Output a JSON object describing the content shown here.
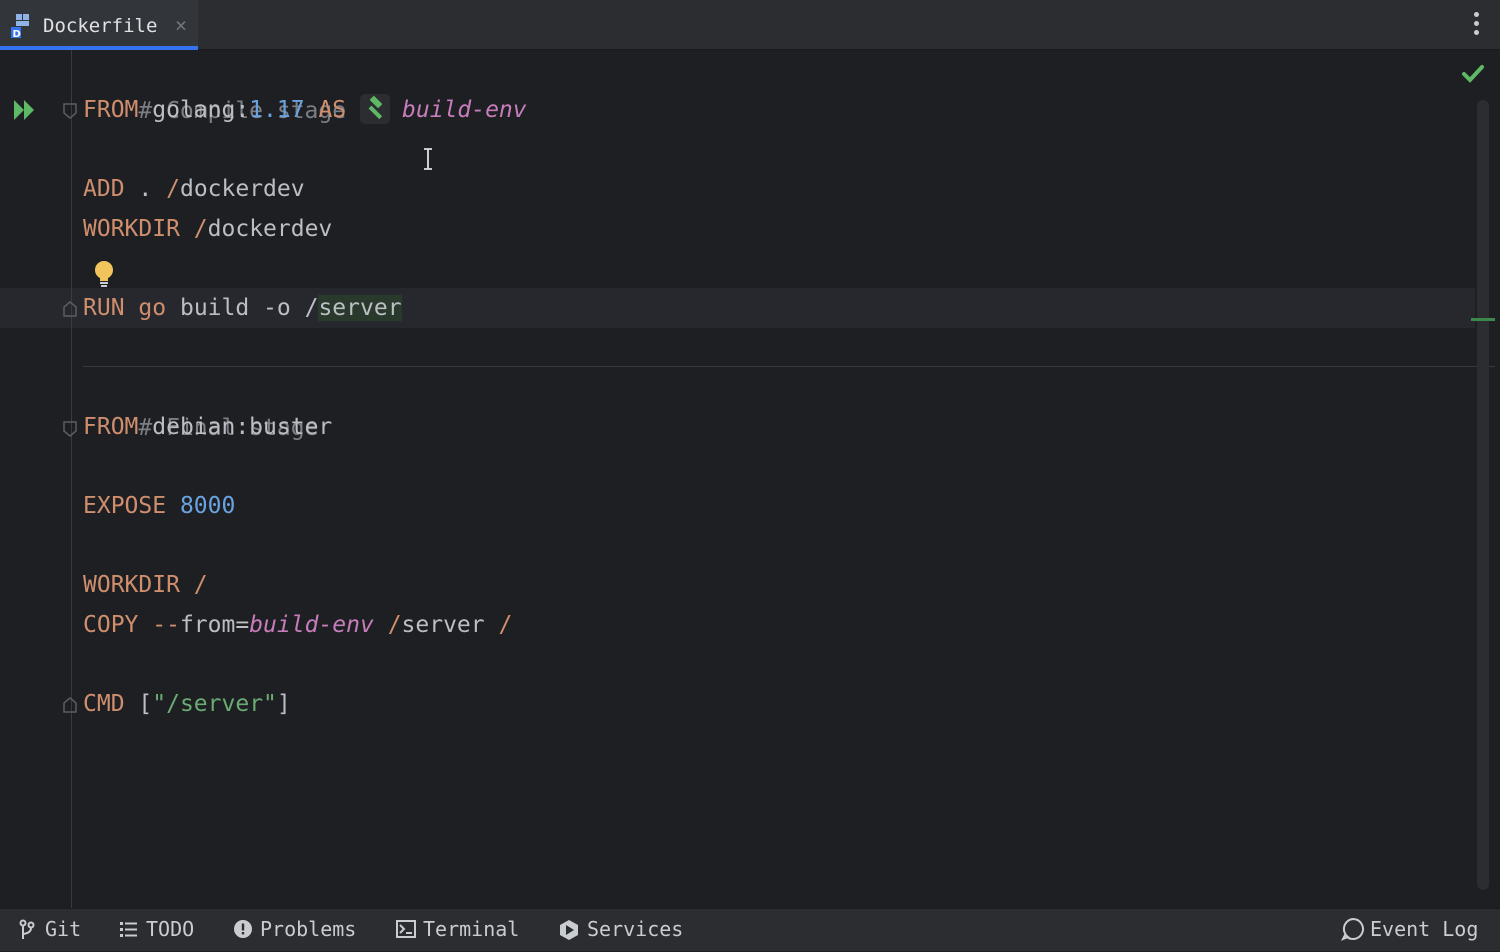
{
  "tab": {
    "label": "Dockerfile",
    "close": "×"
  },
  "code": {
    "l1": {
      "comment": "# Compile stage"
    },
    "l2": {
      "kw": "FROM",
      "image": "golang:",
      "version": "1.17",
      "as": "AS",
      "stage": "build-env"
    },
    "l4": {
      "kw": "ADD",
      "args": ". ",
      "slash": "/",
      "path": "dockerdev"
    },
    "l5": {
      "kw": "WORKDIR",
      "slash": "/",
      "path": "dockerdev"
    },
    "l7": {
      "kw": "RUN",
      "cmd": "go",
      "args": "build -o ",
      "slash": "/",
      "path": "server"
    },
    "l9": {
      "comment": "# Final stage"
    },
    "l10": {
      "kw": "FROM",
      "image": "debian:buster"
    },
    "l12": {
      "kw": "EXPOSE",
      "port": "8000"
    },
    "l14": {
      "kw": "WORKDIR",
      "slash": "/"
    },
    "l15": {
      "kw": "COPY",
      "flag": "--",
      "flagname": "from=",
      "stage": "build-env",
      "slash1": "/",
      "path": "server",
      "slash2": "/"
    },
    "l17": {
      "kw": "CMD",
      "open": "[",
      "str": "\"/server\"",
      "close": "]"
    }
  },
  "status_bar": {
    "git": "Git",
    "todo": "TODO",
    "problems": "Problems",
    "terminal": "Terminal",
    "services": "Services",
    "event_log": "Event Log"
  },
  "colors": {
    "keyword": "#cf8e6d",
    "comment": "#7a7e85",
    "number": "#6aa2e0",
    "string": "#6aab73",
    "stage": "#c77dbb",
    "accent": "#3574f0",
    "ok": "#5fb865"
  },
  "icons": [
    "docker-file-icon",
    "close-icon",
    "more-vertical-icon",
    "run-icon",
    "fold-icon",
    "hammer-icon",
    "lightbulb-icon",
    "text-cursor-icon",
    "check-icon",
    "git-branch-icon",
    "list-icon",
    "problems-icon",
    "terminal-icon",
    "services-icon",
    "event-log-icon"
  ]
}
